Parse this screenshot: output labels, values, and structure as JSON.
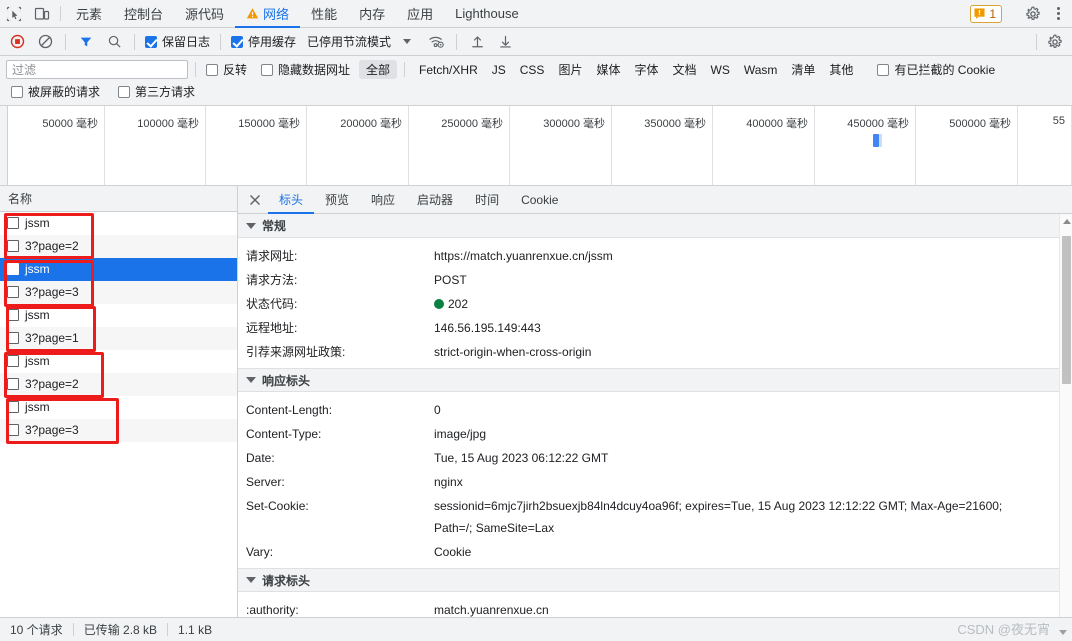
{
  "tabstrip": {
    "icons": [
      {
        "name": "inspect-element-icon",
        "title": "检查元素"
      },
      {
        "name": "device-toolbar-icon",
        "title": "设备工具栏"
      }
    ],
    "tabs": [
      {
        "label": "元素",
        "active": false,
        "warn": false
      },
      {
        "label": "控制台",
        "active": false,
        "warn": false
      },
      {
        "label": "源代码",
        "active": false,
        "warn": false
      },
      {
        "label": "网络",
        "active": true,
        "warn": true
      },
      {
        "label": "性能",
        "active": false,
        "warn": false
      },
      {
        "label": "内存",
        "active": false,
        "warn": false
      },
      {
        "label": "应用",
        "active": false,
        "warn": false
      },
      {
        "label": "Lighthouse",
        "active": false,
        "warn": false
      }
    ],
    "warning_count": "1",
    "settings_icon": "gear-icon",
    "menu_icon": "kebab-menu-icon"
  },
  "nettoolbar": {
    "record_icon": "record-stop-icon",
    "clear_icon": "clear-icon",
    "filter_icon": "filter-funnel-icon",
    "search_icon": "search-icon",
    "preserve_log": {
      "label": "保留日志",
      "checked": true
    },
    "disable_cache": {
      "label": "停用缓存",
      "checked": true
    },
    "throttling": "已停用节流模式",
    "wifi_icon": "network-conditions-icon",
    "import_icon": "import-har-icon",
    "export_icon": "export-har-icon",
    "settings_icon": "network-settings-gear-icon"
  },
  "filterbar": {
    "placeholder": "过滤",
    "value": "",
    "invert": {
      "label": "反转",
      "checked": false
    },
    "hide_data_urls": {
      "label": "隐藏数据网址",
      "checked": false
    },
    "types": [
      {
        "label": "全部",
        "selected": true
      },
      {
        "label": "Fetch/XHR",
        "selected": false
      },
      {
        "label": "JS",
        "selected": false
      },
      {
        "label": "CSS",
        "selected": false
      },
      {
        "label": "图片",
        "selected": false
      },
      {
        "label": "媒体",
        "selected": false
      },
      {
        "label": "字体",
        "selected": false
      },
      {
        "label": "文档",
        "selected": false
      },
      {
        "label": "WS",
        "selected": false
      },
      {
        "label": "Wasm",
        "selected": false
      },
      {
        "label": "清单",
        "selected": false
      },
      {
        "label": "其他",
        "selected": false
      }
    ],
    "blocked_cookies": {
      "label": "有已拦截的 Cookie",
      "checked": false
    },
    "blocked_requests": {
      "label": "被屏蔽的请求",
      "checked": false
    },
    "third_party": {
      "label": "第三方请求",
      "checked": false
    }
  },
  "overview": {
    "ticks": [
      "50000 毫秒",
      "100000 毫秒",
      "150000 毫秒",
      "200000 毫秒",
      "250000 毫秒",
      "300000 毫秒",
      "350000 毫秒",
      "400000 毫秒",
      "450000 毫秒",
      "500000 毫秒",
      "55"
    ],
    "request_marker_time_ms": 450000,
    "bar_color": "#4285f4"
  },
  "requestlist": {
    "header": "名称",
    "rows": [
      {
        "name": "jssm",
        "selected": false
      },
      {
        "name": "3?page=2",
        "selected": false
      },
      {
        "name": "jssm",
        "selected": true
      },
      {
        "name": "3?page=3",
        "selected": false
      },
      {
        "name": "jssm",
        "selected": false
      },
      {
        "name": "3?page=1",
        "selected": false
      },
      {
        "name": "jssm",
        "selected": false
      },
      {
        "name": "3?page=2",
        "selected": false
      },
      {
        "name": "jssm",
        "selected": false
      },
      {
        "name": "3?page=3",
        "selected": false
      }
    ],
    "annotation_color": "#ee1b1b"
  },
  "details": {
    "tabs": [
      {
        "label": "标头",
        "active": true
      },
      {
        "label": "预览",
        "active": false
      },
      {
        "label": "响应",
        "active": false
      },
      {
        "label": "启动器",
        "active": false
      },
      {
        "label": "时间",
        "active": false
      },
      {
        "label": "Cookie",
        "active": false
      }
    ],
    "general": {
      "title": "常规",
      "rows": [
        {
          "key": "请求网址:",
          "value": "https://match.yuanrenxue.cn/jssm"
        },
        {
          "key": "请求方法:",
          "value": "POST"
        },
        {
          "key": "状态代码:",
          "value": "202",
          "status_dot": "#0b8043"
        },
        {
          "key": "远程地址:",
          "value": "146.56.195.149:443"
        },
        {
          "key": "引荐来源网址政策:",
          "value": "strict-origin-when-cross-origin"
        }
      ]
    },
    "response_headers": {
      "title": "响应标头",
      "rows": [
        {
          "key": "Content-Length:",
          "value": "0"
        },
        {
          "key": "Content-Type:",
          "value": "image/jpg"
        },
        {
          "key": "Date:",
          "value": "Tue, 15 Aug 2023 06:12:22 GMT"
        },
        {
          "key": "Server:",
          "value": "nginx"
        },
        {
          "key": "Set-Cookie:",
          "value": "sessionid=6mjc7jirh2bsuexjb84ln4dcuy4oa96f; expires=Tue, 15 Aug 2023 12:12:22 GMT; Max-Age=21600; Path=/; SameSite=Lax"
        },
        {
          "key": "Vary:",
          "value": "Cookie"
        }
      ]
    },
    "request_headers": {
      "title": "请求标头",
      "rows": [
        {
          "key": ":authority:",
          "value": "match.yuanrenxue.cn"
        }
      ]
    }
  },
  "statusbar": {
    "requests": "10 个请求",
    "transferred": "已传输 2.8 kB",
    "resources": "1.1 kB",
    "watermark": "CSDN @夜无宵"
  }
}
